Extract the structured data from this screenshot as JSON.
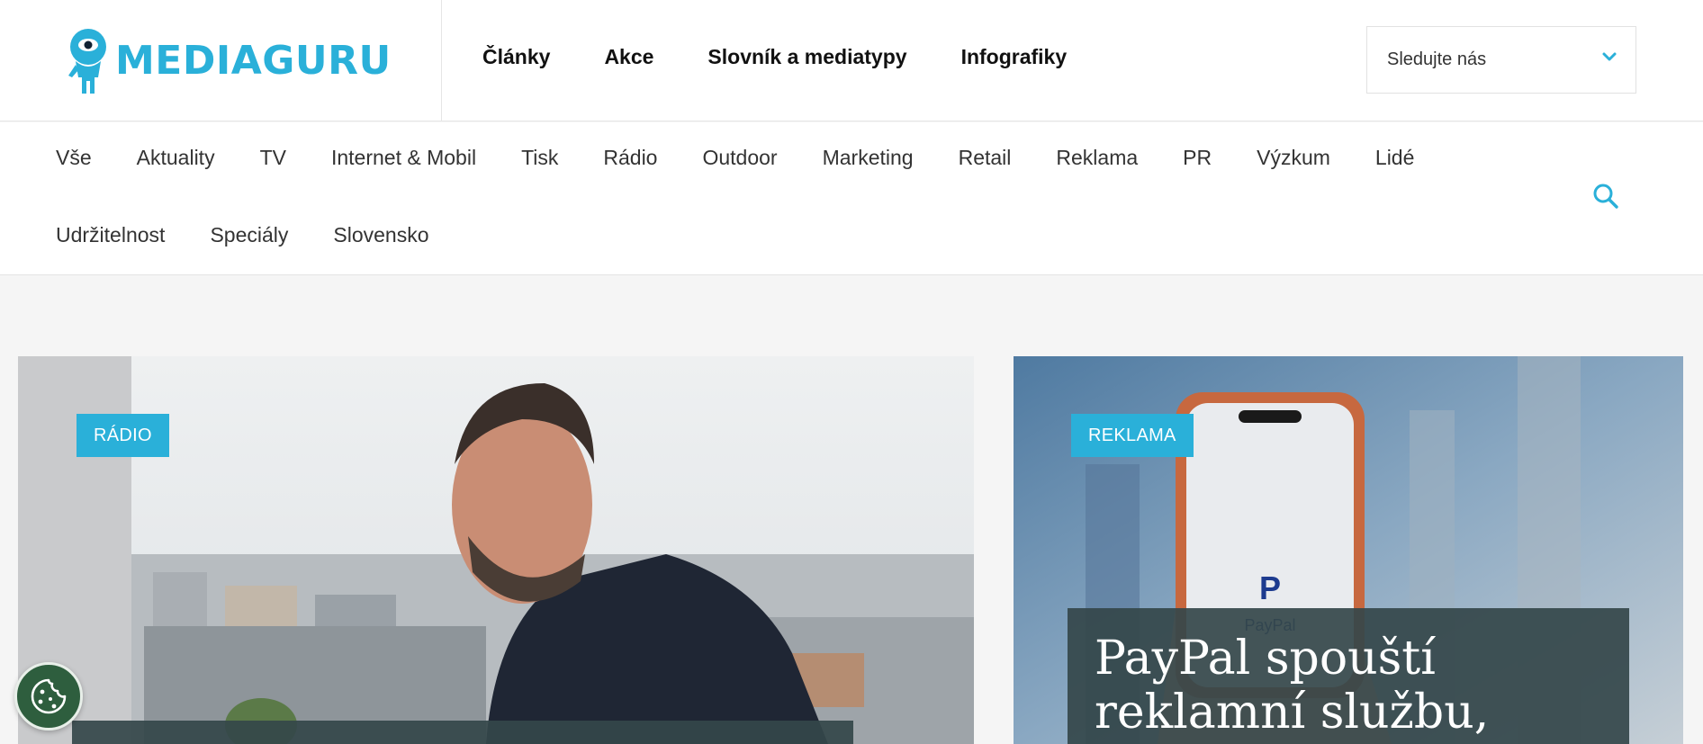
{
  "brand": {
    "name": "MEDIAGURU",
    "accent": "#2ab0d9"
  },
  "main_nav": [
    {
      "label": "Články"
    },
    {
      "label": "Akce"
    },
    {
      "label": "Slovník a mediatypy"
    },
    {
      "label": "Infografiky"
    }
  ],
  "follow": {
    "label": "Sledujte nás",
    "icon": "chevron-down-icon"
  },
  "categories": {
    "row1": [
      "Vše",
      "Aktuality",
      "TV",
      "Internet & Mobil",
      "Tisk",
      "Rádio",
      "Outdoor",
      "Marketing",
      "Retail",
      "Reklama",
      "PR",
      "Výzkum",
      "Lidé"
    ],
    "row2": [
      "Udržitelnost",
      "Speciály",
      "Slovensko"
    ]
  },
  "search": {
    "icon": "search-icon"
  },
  "articles": [
    {
      "badge": "RÁDIO",
      "headline": ""
    },
    {
      "badge": "REKLAMA",
      "headline_line1": "PayPal spouští",
      "headline_line2": "reklamní službu,"
    }
  ],
  "cookie": {
    "icon": "cookie-icon"
  }
}
